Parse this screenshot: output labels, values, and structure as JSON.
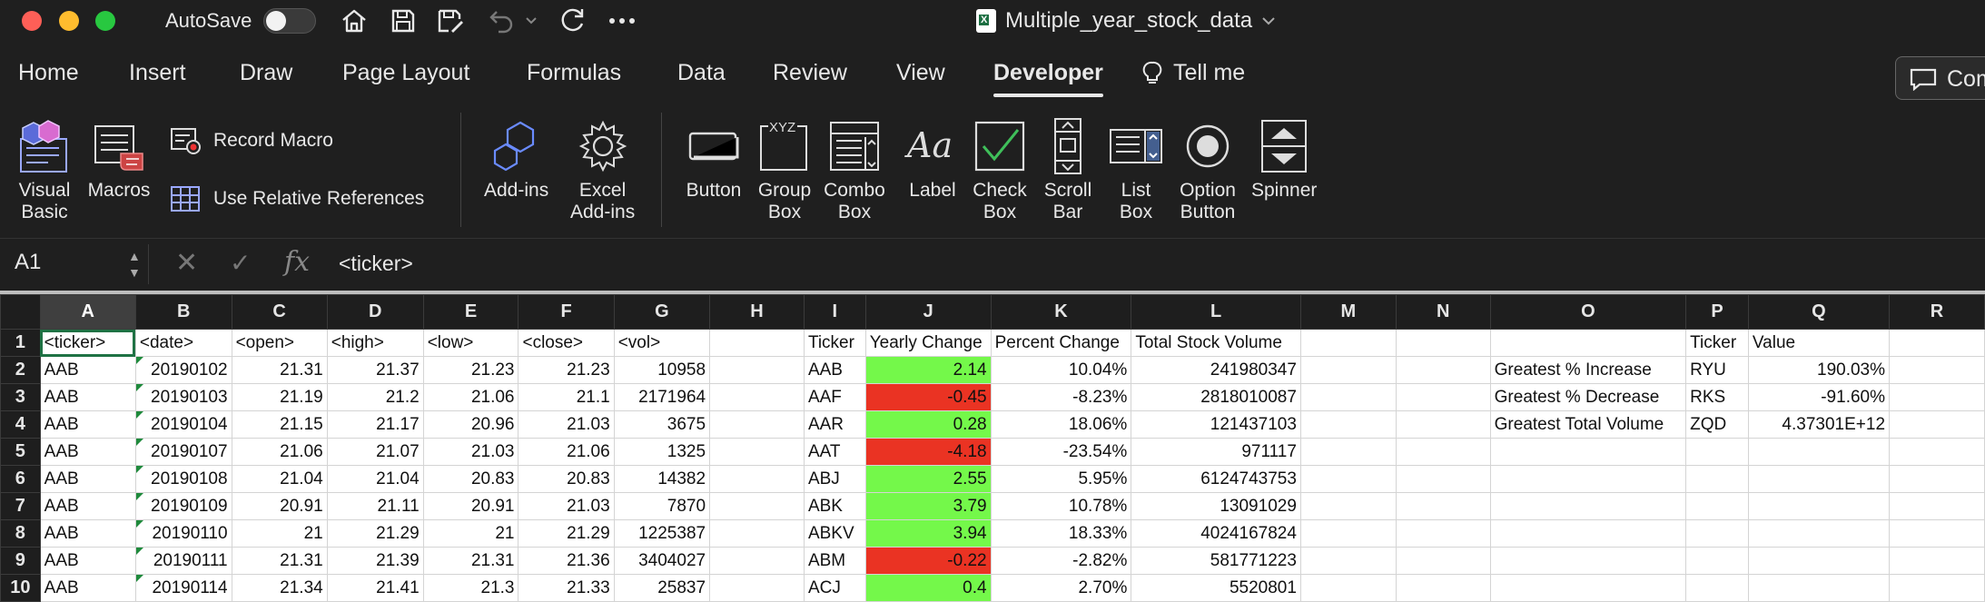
{
  "titlebar": {
    "autosave_label": "AutoSave",
    "document_title": "Multiple_year_stock_data",
    "icons": [
      "home-icon",
      "save-icon",
      "save-as-icon",
      "undo-icon",
      "redo-icon",
      "more-icon"
    ]
  },
  "tabs": [
    {
      "label": "Home",
      "active": false
    },
    {
      "label": "Insert",
      "active": false
    },
    {
      "label": "Draw",
      "active": false
    },
    {
      "label": "Page Layout",
      "active": false
    },
    {
      "label": "Formulas",
      "active": false
    },
    {
      "label": "Data",
      "active": false
    },
    {
      "label": "Review",
      "active": false
    },
    {
      "label": "View",
      "active": false
    },
    {
      "label": "Developer",
      "active": true
    },
    {
      "label": "Tell me",
      "active": false
    }
  ],
  "comments_label": "Comments",
  "ribbon": {
    "visual_basic": "Visual\nBasic",
    "macros": "Macros",
    "record_macro": "Record Macro",
    "use_relative": "Use Relative References",
    "add_ins": "Add-ins",
    "excel_add_ins": "Excel\nAdd-ins",
    "button": "Button",
    "group_box": "Group\nBox",
    "combo_box": "Combo\nBox",
    "label": "Label",
    "check_box": "Check\nBox",
    "scroll_bar": "Scroll\nBar",
    "list_box": "List\nBox",
    "option_button": "Option\nButton",
    "spinner": "Spinner"
  },
  "formula_bar": {
    "name_box": "A1",
    "fx": "fx",
    "content": "<ticker>"
  },
  "grid": {
    "columns": [
      "A",
      "B",
      "C",
      "D",
      "E",
      "F",
      "G",
      "H",
      "I",
      "J",
      "K",
      "L",
      "M",
      "N",
      "O",
      "P",
      "Q",
      "R"
    ],
    "rows": [
      [
        "<ticker>",
        "<date>",
        "<open>",
        "<high>",
        "<low>",
        "<close>",
        "<vol>",
        "",
        "Ticker",
        "Yearly Change",
        "Percent Change",
        "Total Stock Volume",
        "",
        "",
        "",
        "Ticker",
        "Value",
        ""
      ],
      [
        "AAB",
        "20190102",
        "21.31",
        "21.37",
        "21.23",
        "21.23",
        "10958",
        "",
        "AAB",
        "2.14",
        "10.04%",
        "241980347",
        "",
        "",
        "Greatest  % Increase",
        "RYU",
        "190.03%",
        ""
      ],
      [
        "AAB",
        "20190103",
        "21.19",
        "21.2",
        "21.06",
        "21.1",
        "2171964",
        "",
        "AAF",
        "-0.45",
        "-8.23%",
        "2818010087",
        "",
        "",
        "Greatest % Decrease",
        "RKS",
        "-91.60%",
        ""
      ],
      [
        "AAB",
        "20190104",
        "21.15",
        "21.17",
        "20.96",
        "21.03",
        "3675",
        "",
        "AAR",
        "0.28",
        "18.06%",
        "121437103",
        "",
        "",
        "Greatest Total Volume",
        "ZQD",
        "4.37301E+12",
        ""
      ],
      [
        "AAB",
        "20190107",
        "21.06",
        "21.07",
        "21.03",
        "21.06",
        "1325",
        "",
        "AAT",
        "-4.18",
        "-23.54%",
        "971117",
        "",
        "",
        "",
        "",
        "",
        ""
      ],
      [
        "AAB",
        "20190108",
        "21.04",
        "21.04",
        "20.83",
        "20.83",
        "14382",
        "",
        "ABJ",
        "2.55",
        "5.95%",
        "6124743753",
        "",
        "",
        "",
        "",
        "",
        ""
      ],
      [
        "AAB",
        "20190109",
        "20.91",
        "21.11",
        "20.91",
        "21.03",
        "7870",
        "",
        "ABK",
        "3.79",
        "10.78%",
        "13091029",
        "",
        "",
        "",
        "",
        "",
        ""
      ],
      [
        "AAB",
        "20190110",
        "21",
        "21.29",
        "21",
        "21.29",
        "1225387",
        "",
        "ABKV",
        "3.94",
        "18.33%",
        "4024167824",
        "",
        "",
        "",
        "",
        "",
        ""
      ],
      [
        "AAB",
        "20190111",
        "21.31",
        "21.39",
        "21.31",
        "21.36",
        "3404027",
        "",
        "ABM",
        "-0.22",
        "-2.82%",
        "581771223",
        "",
        "",
        "",
        "",
        "",
        ""
      ],
      [
        "AAB",
        "20190114",
        "21.34",
        "21.41",
        "21.3",
        "21.33",
        "25837",
        "",
        "ACJ",
        "0.4",
        "2.70%",
        "5520801",
        "",
        "",
        "",
        "",
        "",
        ""
      ]
    ],
    "change_colors": {
      "positive": "#74f84a",
      "negative": "#ea3323"
    }
  }
}
